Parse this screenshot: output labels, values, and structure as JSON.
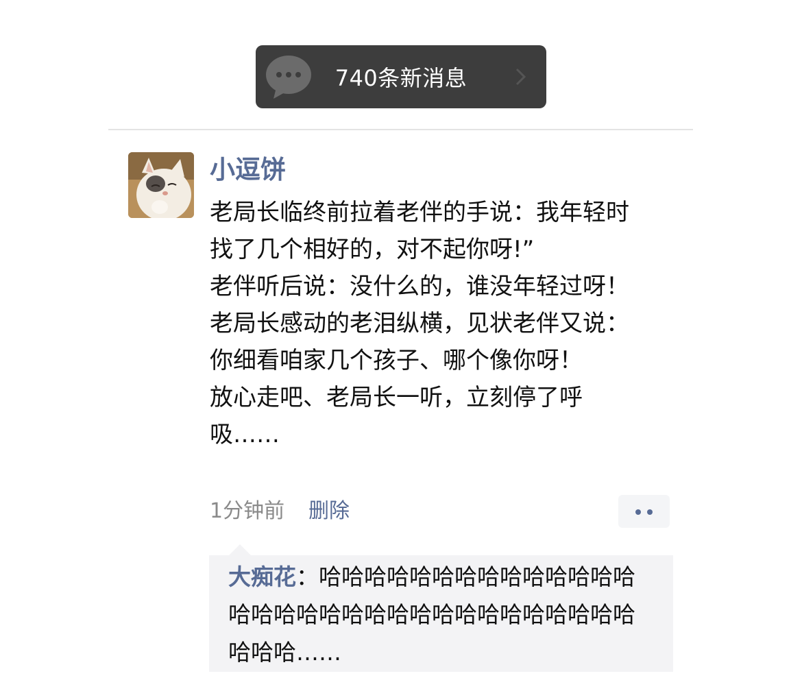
{
  "banner": {
    "text": "740条新消息",
    "icon": "chat-bubble-icon",
    "chevron_icon": "chevron-right-icon"
  },
  "post": {
    "avatar": "cat-avatar",
    "username": "小逗饼",
    "body": "老局长临终前拉着老伴的手说：我年轻时找了几个相好的，对不起你呀!”\n老伴听后说：没什么的，谁没年轻过呀！老局长感动的老泪纵横，见状老伴又说：\n你细看咱家几个孩子、哪个像你呀！\n放心走吧、老局长一听，立刻停了呼吸……",
    "time": "1分钟前",
    "delete_label": "删除",
    "more_icon": "more-dots-icon"
  },
  "comment": {
    "author": "大痴花",
    "separator": "：",
    "text": "哈哈哈哈哈哈哈哈哈哈哈哈哈哈哈哈哈哈哈哈哈哈哈哈哈哈哈哈哈哈哈哈哈哈哈……"
  },
  "colors": {
    "link_blue": "#576b95",
    "banner_bg": "#3d3d3d",
    "comment_bg": "#f3f3f5"
  }
}
